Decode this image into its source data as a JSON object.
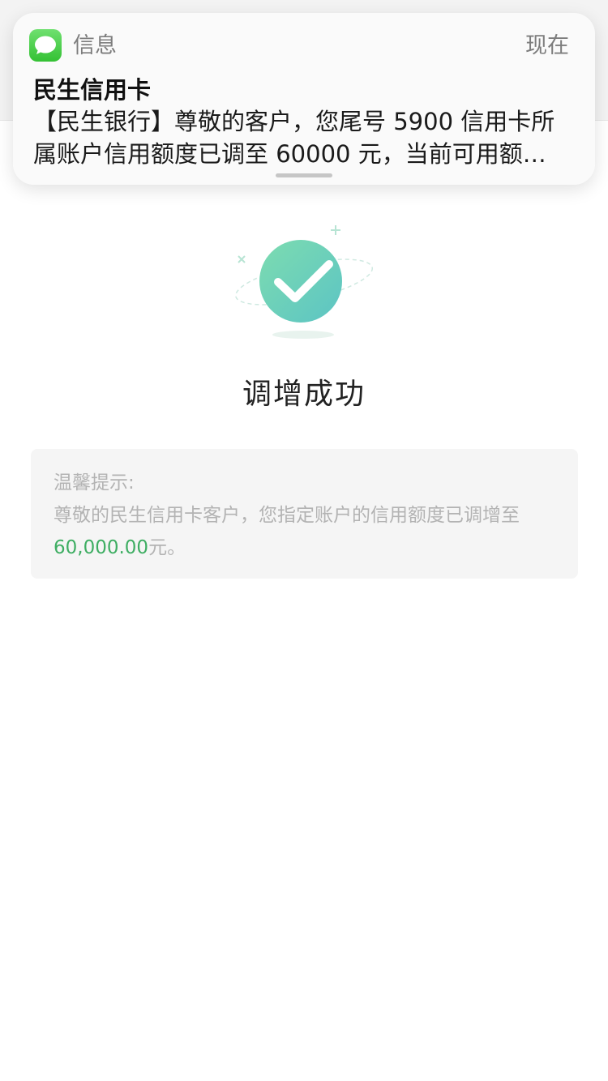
{
  "notification": {
    "app_icon": "messages-bubble-icon",
    "app_name": "信息",
    "time": "现在",
    "sender": "民生信用卡",
    "body_line1": "【民生银行】尊敬的客户，您尾号 5900 信用卡所",
    "body_line2": "属账户信用额度已调至 60000 元，当前可用额…"
  },
  "result": {
    "icon": "success-checkmark-icon",
    "title": "调增成功"
  },
  "tips": {
    "heading": "温馨提示:",
    "line1": "尊敬的民生信用卡客户，您指定账户的信用额度已调增至",
    "amount": "60,000.00",
    "suffix": "元。"
  },
  "colors": {
    "amount_green": "#3fae63",
    "check_gradient_start": "#7ddcb0",
    "check_gradient_end": "#5cc4c4",
    "messages_green": "#34c134"
  }
}
